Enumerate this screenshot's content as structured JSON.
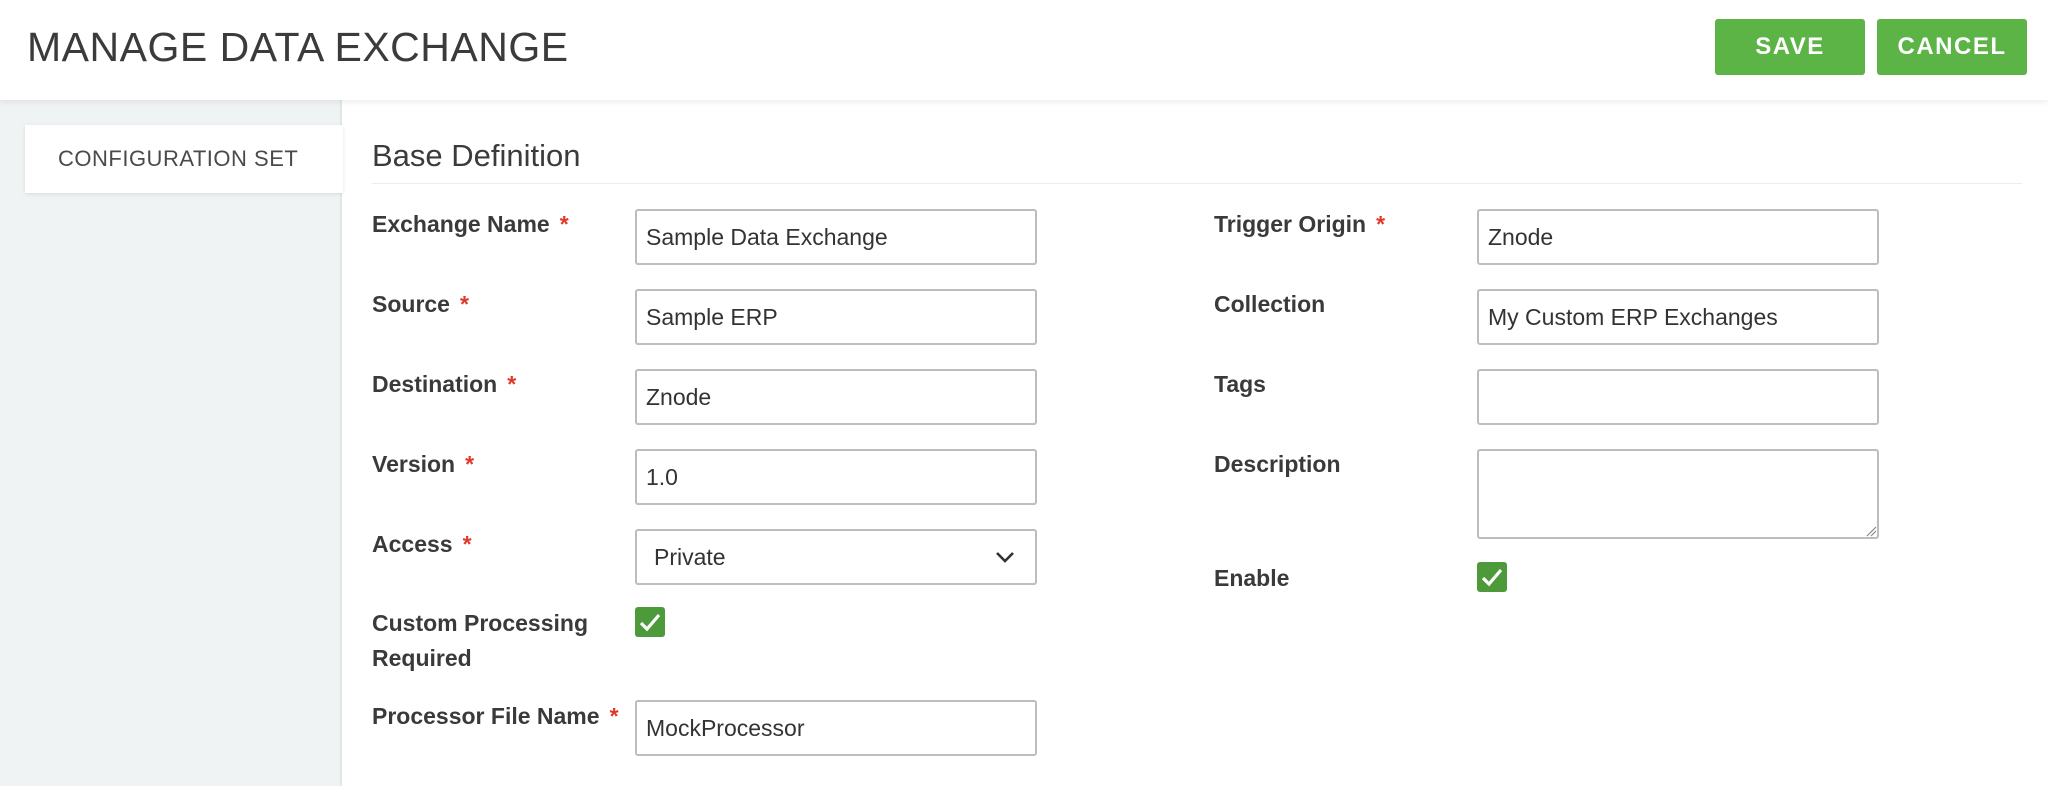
{
  "header": {
    "title": "MANAGE DATA EXCHANGE",
    "save_label": "SAVE",
    "cancel_label": "CANCEL"
  },
  "sidebar": {
    "items": [
      {
        "label": "CONFIGURATION SET"
      }
    ]
  },
  "section": {
    "title": "Base Definition"
  },
  "form": {
    "exchange_name": {
      "label": "Exchange Name",
      "value": "Sample Data Exchange",
      "required": "*"
    },
    "source": {
      "label": "Source",
      "value": "Sample ERP",
      "required": "*"
    },
    "destination": {
      "label": "Destination",
      "value": "Znode",
      "required": "*"
    },
    "version": {
      "label": "Version",
      "value": "1.0",
      "required": "*"
    },
    "access": {
      "label": "Access",
      "value": "Private",
      "required": "*"
    },
    "custom_processing": {
      "label_line1": "Custom Processing",
      "label_line2": "Required",
      "checked": true
    },
    "processor_file_name": {
      "label": "Processor File Name",
      "value": "MockProcessor",
      "required": "*"
    },
    "trigger_origin": {
      "label": "Trigger Origin",
      "value": "Znode",
      "required": "*"
    },
    "collection": {
      "label": "Collection",
      "value": "My Custom ERP Exchanges"
    },
    "tags": {
      "label": "Tags",
      "value": ""
    },
    "description": {
      "label": "Description",
      "value": ""
    },
    "enable": {
      "label": "Enable",
      "checked": true
    }
  },
  "colors": {
    "accent_green": "#5cb346",
    "checkbox_green": "#4c9a3a",
    "required_red": "#e0382b",
    "sidebar_bg": "#f0f3f3"
  },
  "icons": {
    "dropdown": "chevron-down-icon",
    "check": "check-icon"
  }
}
